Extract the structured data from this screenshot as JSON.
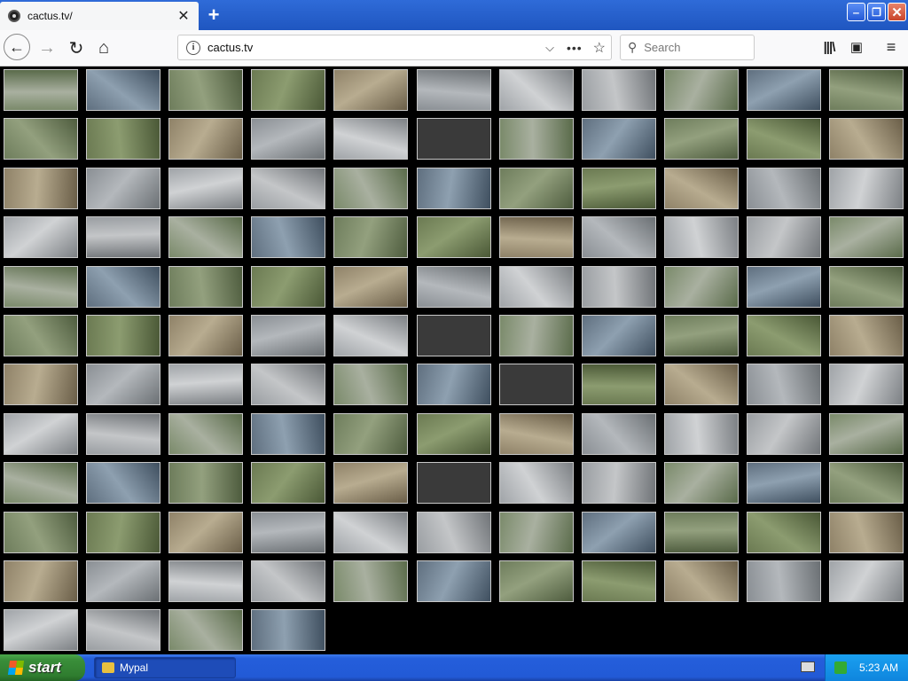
{
  "tab": {
    "title": "cactus.tv/",
    "close_label": "✕"
  },
  "window_controls": {
    "minimize": "‒",
    "maximize": "❐",
    "close": "✕"
  },
  "nav": {
    "back": "←",
    "forward": "→",
    "reload": "↻",
    "home": "⌂"
  },
  "urlbar": {
    "url": "cactus.tv",
    "info_icon": "i",
    "dropdown": "⌵",
    "dots": "•••",
    "star": "☆"
  },
  "search": {
    "placeholder": "Search",
    "value": ""
  },
  "toolbar": {
    "library": "|||\\",
    "sidebar": "▣",
    "menu": "≡"
  },
  "grid": {
    "columns": 11,
    "rows": 12,
    "count": 125,
    "blank_indices": [
      16,
      60,
      72,
      93
    ]
  },
  "taskbar": {
    "start_label": "start",
    "task_label": "Mypal",
    "clock": "5:23 AM"
  },
  "colors": {
    "tab_strip": "#2f6bd8",
    "taskbar": "#245edb",
    "start": "#3a8f3a",
    "tray": "#0f85dd"
  }
}
